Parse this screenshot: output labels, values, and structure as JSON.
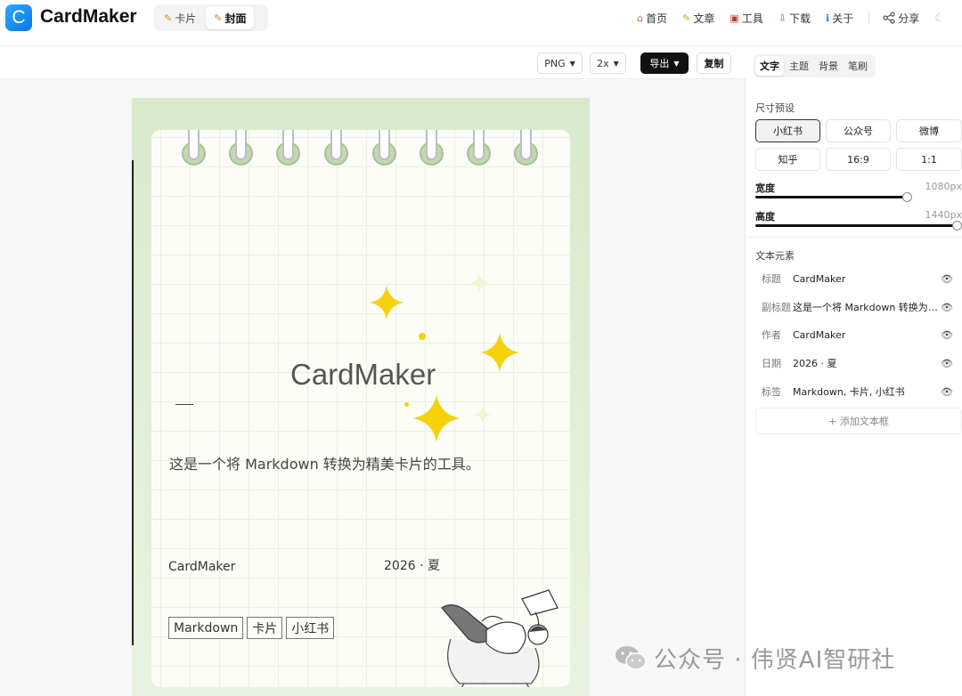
{
  "app": {
    "logo_letter": "C",
    "title": "CardMaker"
  },
  "mode_tabs": [
    {
      "label": "卡片",
      "icon": "✎"
    },
    {
      "label": "封面",
      "icon": "✎"
    }
  ],
  "nav": {
    "items": [
      {
        "label": "首页",
        "icon": "⌂"
      },
      {
        "label": "文章",
        "icon": "✎"
      },
      {
        "label": "工具",
        "icon": "▣"
      },
      {
        "label": "下载",
        "icon": "⇩"
      },
      {
        "label": "关于",
        "icon": "ℹ"
      }
    ],
    "share_label": "分享",
    "theme_icon": "☾"
  },
  "export_bar": {
    "format": "PNG",
    "scale": "2x",
    "export_label": "导出",
    "copy_label": "复制"
  },
  "card": {
    "title": "CardMaker",
    "subtitle": "这是一个将 Markdown 转换为精美卡片的工具。",
    "author": "CardMaker",
    "date": "2026 · 夏",
    "tags": [
      "Markdown",
      "卡片",
      "小红书"
    ]
  },
  "panel": {
    "tabs": [
      "文字",
      "主题",
      "背景",
      "笔刷"
    ],
    "size_preset_label": "尺寸预设",
    "presets": [
      "小红书",
      "公众号",
      "微博",
      "知乎",
      "16:9",
      "1:1"
    ],
    "width_label": "宽度",
    "width_value": "1080px",
    "width_fill": 0.75,
    "height_label": "高度",
    "height_value": "1440px",
    "height_fill": 1.0,
    "text_elements_label": "文本元素",
    "elements": [
      {
        "name": "标题",
        "value": "CardMaker"
      },
      {
        "name": "副标题",
        "value": "这是一个将 Markdown 转换为精美卡片的工具。"
      },
      {
        "name": "作者",
        "value": "CardMaker"
      },
      {
        "name": "日期",
        "value": "2026 · 夏"
      },
      {
        "name": "标签",
        "value": "Markdown, 卡片, 小红书"
      }
    ],
    "add_label": "+ 添加文本框"
  },
  "watermark": {
    "text": "公众号 · 伟贤AI智研社"
  }
}
